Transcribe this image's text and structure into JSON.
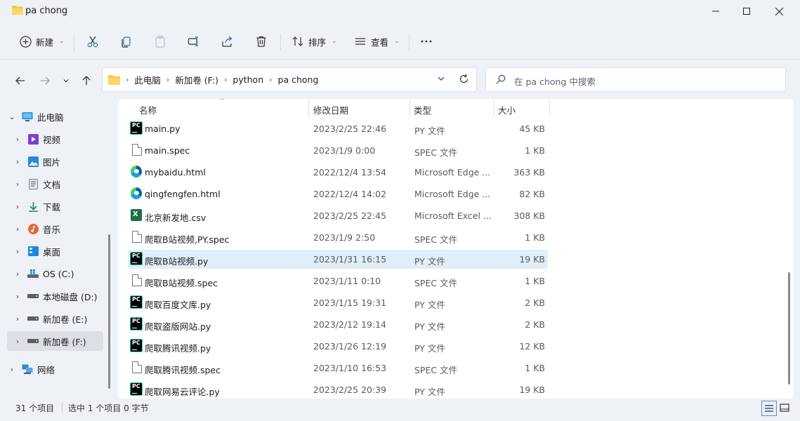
{
  "window": {
    "title": "pa chong"
  },
  "toolbar": {
    "new_label": "新建",
    "sort_label": "排序",
    "view_label": "查看"
  },
  "address": {
    "crumbs": [
      "此电脑",
      "新加卷 (F:)",
      "python",
      "pa chong"
    ]
  },
  "search": {
    "placeholder": "在 pa chong 中搜索"
  },
  "sidebar": {
    "items": [
      {
        "label": "此电脑",
        "icon": "computer-icon"
      },
      {
        "label": "视频",
        "icon": "videos-icon"
      },
      {
        "label": "图片",
        "icon": "pictures-icon"
      },
      {
        "label": "文档",
        "icon": "documents-icon"
      },
      {
        "label": "下载",
        "icon": "downloads-icon"
      },
      {
        "label": "音乐",
        "icon": "music-icon"
      },
      {
        "label": "桌面",
        "icon": "desktop-icon"
      },
      {
        "label": "OS (C:)",
        "icon": "os-drive-icon"
      },
      {
        "label": "本地磁盘 (D:)",
        "icon": "drive-icon"
      },
      {
        "label": "新加卷 (E:)",
        "icon": "drive-icon"
      },
      {
        "label": "新加卷 (F:)",
        "icon": "drive-icon"
      },
      {
        "label": "网络",
        "icon": "network-icon"
      }
    ]
  },
  "columns": {
    "name": "名称",
    "date": "修改日期",
    "type": "类型",
    "size": "大小"
  },
  "files": [
    {
      "name": "main.py",
      "date": "2023/2/25 22:46",
      "type": "PY 文件",
      "size": "45 KB",
      "icon": "pycharm-icon"
    },
    {
      "name": "main.spec",
      "date": "2023/1/9 0:00",
      "type": "SPEC 文件",
      "size": "1 KB",
      "icon": "document-icon"
    },
    {
      "name": "mybaidu.html",
      "date": "2022/12/4 13:54",
      "type": "Microsoft Edge ...",
      "size": "363 KB",
      "icon": "edge-icon"
    },
    {
      "name": "qingfengfen.html",
      "date": "2022/12/4 14:02",
      "type": "Microsoft Edge ...",
      "size": "82 KB",
      "icon": "edge-icon"
    },
    {
      "name": "北京新发地.csv",
      "date": "2023/2/25 22:45",
      "type": "Microsoft Excel ...",
      "size": "308 KB",
      "icon": "excel-icon"
    },
    {
      "name": "爬取B站视频,PY.spec",
      "date": "2023/1/9 2:50",
      "type": "SPEC 文件",
      "size": "1 KB",
      "icon": "document-icon"
    },
    {
      "name": "爬取B站视频.py",
      "date": "2023/1/31 16:15",
      "type": "PY 文件",
      "size": "19 KB",
      "icon": "pycharm-icon"
    },
    {
      "name": "爬取B站视频.spec",
      "date": "2023/1/11 0:10",
      "type": "SPEC 文件",
      "size": "1 KB",
      "icon": "document-icon"
    },
    {
      "name": "爬取百度文库.py",
      "date": "2023/1/15 19:31",
      "type": "PY 文件",
      "size": "2 KB",
      "icon": "pycharm-icon"
    },
    {
      "name": "爬取盗版网站.py",
      "date": "2023/2/12 19:14",
      "type": "PY 文件",
      "size": "2 KB",
      "icon": "pycharm-icon"
    },
    {
      "name": "爬取腾讯视频.py",
      "date": "2023/1/26 12:19",
      "type": "PY 文件",
      "size": "12 KB",
      "icon": "pycharm-icon"
    },
    {
      "name": "爬取腾讯视频.spec",
      "date": "2023/1/10 16:53",
      "type": "SPEC 文件",
      "size": "1 KB",
      "icon": "document-icon"
    },
    {
      "name": "爬取网易云评论.py",
      "date": "2023/2/25 20:39",
      "type": "PY 文件",
      "size": "19 KB",
      "icon": "pycharm-icon"
    }
  ],
  "status": {
    "count": "31 个项目",
    "selection": "选中 1 个项目 0 字节"
  }
}
